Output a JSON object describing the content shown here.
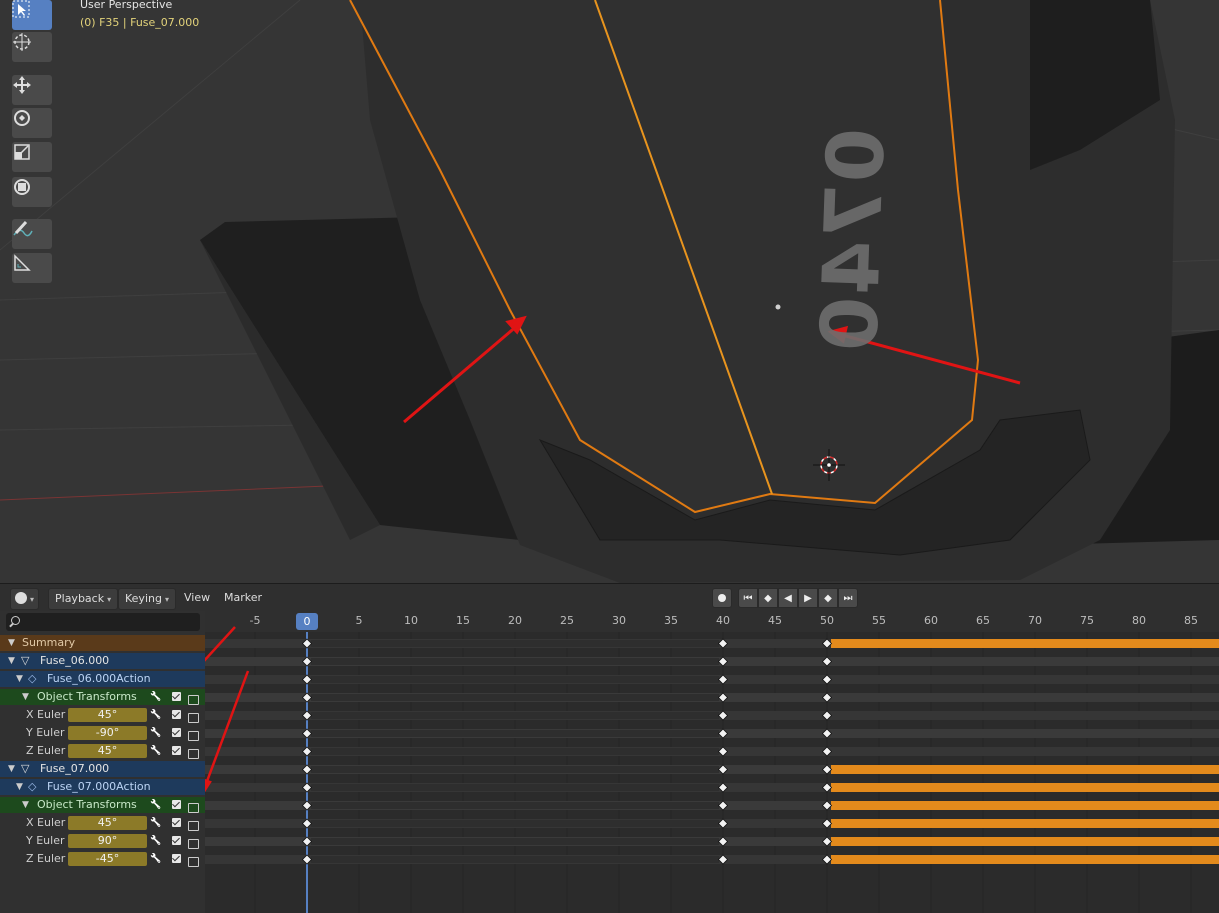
{
  "viewport": {
    "view_name": "User Perspective",
    "object_info": "(0) F35 | Fuse_07.000",
    "decal_text": "0740"
  },
  "toolbar": {
    "tools": [
      {
        "name": "select-box-tool",
        "icon": "cursor-select-icon",
        "active": true
      },
      {
        "name": "cursor-tool",
        "icon": "crosshair-icon",
        "active": false
      },
      {
        "name": "move-tool",
        "icon": "move-arrows-icon",
        "active": false
      },
      {
        "name": "rotate-tool",
        "icon": "rotate-icon",
        "active": false
      },
      {
        "name": "scale-tool",
        "icon": "scale-icon",
        "active": false
      },
      {
        "name": "transform-tool",
        "icon": "transform-icon",
        "active": false
      },
      {
        "name": "annotate-tool",
        "icon": "pencil-icon",
        "active": false
      },
      {
        "name": "measure-tool",
        "icon": "ruler-icon",
        "active": false
      }
    ]
  },
  "timeline_header": {
    "editor_icon": "clock-icon",
    "playback_label": "Playback",
    "keying_label": "Keying",
    "view_label": "View",
    "marker_label": "Marker",
    "controls": [
      "record-icon",
      "jump-start-icon",
      "prev-keyframe-icon",
      "play-reverse-icon",
      "play-icon",
      "next-keyframe-icon",
      "jump-end-icon"
    ]
  },
  "ruler": {
    "frames": [
      "-5",
      "5",
      "10",
      "15",
      "20",
      "25",
      "30",
      "35",
      "40",
      "45",
      "50",
      "55",
      "60",
      "65",
      "70",
      "75",
      "80",
      "85"
    ],
    "current_frame": "0"
  },
  "channels": {
    "search_placeholder": "",
    "rows": [
      {
        "type": "summary",
        "label": "Summary",
        "bar": false
      },
      {
        "type": "object",
        "label": "Fuse_06.000",
        "bar": false
      },
      {
        "type": "action",
        "label": "Fuse_06.000Action",
        "bar": false
      },
      {
        "type": "group",
        "label": "Object Transforms",
        "bar": false
      },
      {
        "type": "fcurve",
        "label": "X Euler R",
        "value": "45°",
        "bar": false
      },
      {
        "type": "fcurve",
        "label": "Y Euler R",
        "value": "-90°",
        "bar": false
      },
      {
        "type": "fcurve",
        "label": "Z Euler R",
        "value": "45°",
        "bar": false
      },
      {
        "type": "object",
        "label": "Fuse_07.000",
        "bar": true
      },
      {
        "type": "action",
        "label": "Fuse_07.000Action",
        "bar": true
      },
      {
        "type": "group",
        "label": "Object Transforms",
        "bar": true
      },
      {
        "type": "fcurve",
        "label": "X Euler R",
        "value": "45°",
        "bar": true
      },
      {
        "type": "fcurve",
        "label": "Y Euler R",
        "value": "90°",
        "bar": true
      },
      {
        "type": "fcurve",
        "label": "Z Euler R",
        "value": "-45°",
        "bar": true
      }
    ]
  },
  "keyframes": [
    0,
    40,
    50
  ],
  "colors": {
    "selection_outline": "#f08a1c",
    "hold_bar": "#e38a1c",
    "annotation_arrow": "#e01414",
    "current_frame": "#5680c2"
  }
}
